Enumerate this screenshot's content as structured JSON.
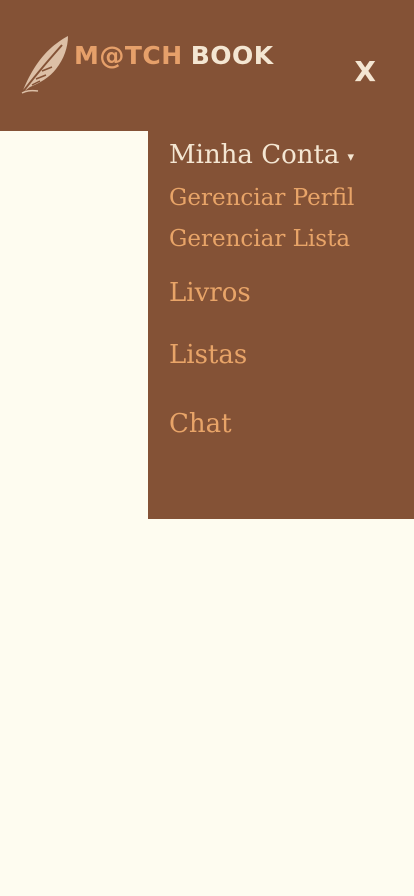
{
  "header": {
    "logo": {
      "match_text": "M@TCH",
      "book_text": "BOOK",
      "icon": "feather-quill-icon"
    },
    "close_label": "X"
  },
  "menu": {
    "account_label": "Minha Conta",
    "account_caret": "▾",
    "sub_items": [
      {
        "label": "Gerenciar Perfil"
      },
      {
        "label": "Gerenciar Lista"
      }
    ],
    "links": [
      {
        "label": "Livros"
      },
      {
        "label": "Listas"
      },
      {
        "label": "Chat"
      }
    ]
  },
  "colors": {
    "brown": "#845236",
    "cream": "#fefcf0",
    "accent_orange": "#e8a468",
    "light_text": "#f4e6d2"
  }
}
